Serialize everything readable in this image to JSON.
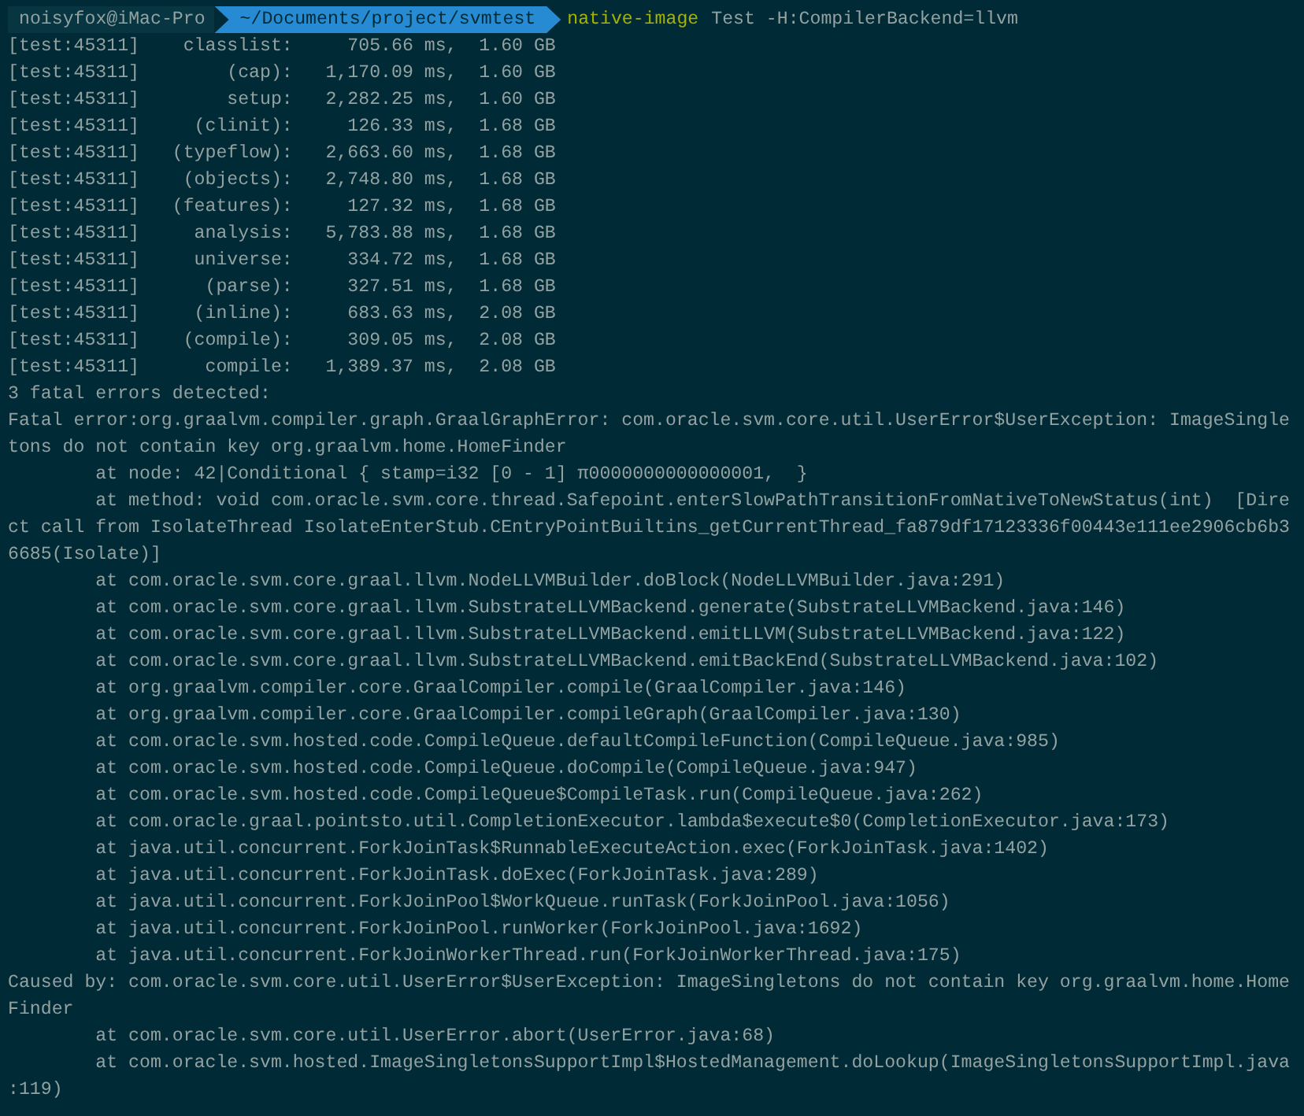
{
  "prompt": {
    "user": "noisyfox@iMac-Pro",
    "path": "~/Documents/project/svmtest",
    "command": "native-image",
    "args": "Test -H:CompilerBackend=llvm"
  },
  "output_lines": [
    "[test:45311]    classlist:     705.66 ms,  1.60 GB",
    "[test:45311]        (cap):   1,170.09 ms,  1.60 GB",
    "[test:45311]        setup:   2,282.25 ms,  1.60 GB",
    "[test:45311]     (clinit):     126.33 ms,  1.68 GB",
    "[test:45311]   (typeflow):   2,663.60 ms,  1.68 GB",
    "[test:45311]    (objects):   2,748.80 ms,  1.68 GB",
    "[test:45311]   (features):     127.32 ms,  1.68 GB",
    "[test:45311]     analysis:   5,783.88 ms,  1.68 GB",
    "[test:45311]     universe:     334.72 ms,  1.68 GB",
    "[test:45311]      (parse):     327.51 ms,  1.68 GB",
    "[test:45311]     (inline):     683.63 ms,  2.08 GB",
    "[test:45311]    (compile):     309.05 ms,  2.08 GB",
    "[test:45311]      compile:   1,389.37 ms,  2.08 GB",
    "3 fatal errors detected:",
    "Fatal error:org.graalvm.compiler.graph.GraalGraphError: com.oracle.svm.core.util.UserError$UserException: ImageSingle",
    "tons do not contain key org.graalvm.home.HomeFinder",
    "        at node: 42|Conditional { stamp=i32 [0 - 1] π0000000000000001,  }",
    "        at method: void com.oracle.svm.core.thread.Safepoint.enterSlowPathTransitionFromNativeToNewStatus(int)  [Dire",
    "ct call from IsolateThread IsolateEnterStub.CEntryPointBuiltins_getCurrentThread_fa879df17123336f00443e111ee2906cb6b3",
    "6685(Isolate)]",
    "        at com.oracle.svm.core.graal.llvm.NodeLLVMBuilder.doBlock(NodeLLVMBuilder.java:291)",
    "        at com.oracle.svm.core.graal.llvm.SubstrateLLVMBackend.generate(SubstrateLLVMBackend.java:146)",
    "        at com.oracle.svm.core.graal.llvm.SubstrateLLVMBackend.emitLLVM(SubstrateLLVMBackend.java:122)",
    "        at com.oracle.svm.core.graal.llvm.SubstrateLLVMBackend.emitBackEnd(SubstrateLLVMBackend.java:102)",
    "        at org.graalvm.compiler.core.GraalCompiler.compile(GraalCompiler.java:146)",
    "        at org.graalvm.compiler.core.GraalCompiler.compileGraph(GraalCompiler.java:130)",
    "        at com.oracle.svm.hosted.code.CompileQueue.defaultCompileFunction(CompileQueue.java:985)",
    "        at com.oracle.svm.hosted.code.CompileQueue.doCompile(CompileQueue.java:947)",
    "        at com.oracle.svm.hosted.code.CompileQueue$CompileTask.run(CompileQueue.java:262)",
    "        at com.oracle.graal.pointsto.util.CompletionExecutor.lambda$execute$0(CompletionExecutor.java:173)",
    "        at java.util.concurrent.ForkJoinTask$RunnableExecuteAction.exec(ForkJoinTask.java:1402)",
    "        at java.util.concurrent.ForkJoinTask.doExec(ForkJoinTask.java:289)",
    "        at java.util.concurrent.ForkJoinPool$WorkQueue.runTask(ForkJoinPool.java:1056)",
    "        at java.util.concurrent.ForkJoinPool.runWorker(ForkJoinPool.java:1692)",
    "        at java.util.concurrent.ForkJoinWorkerThread.run(ForkJoinWorkerThread.java:175)",
    "Caused by: com.oracle.svm.core.util.UserError$UserException: ImageSingletons do not contain key org.graalvm.home.Home",
    "Finder",
    "        at com.oracle.svm.core.util.UserError.abort(UserError.java:68)",
    "        at com.oracle.svm.hosted.ImageSingletonsSupportImpl$HostedManagement.doLookup(ImageSingletonsSupportImpl.java",
    ":119)"
  ]
}
